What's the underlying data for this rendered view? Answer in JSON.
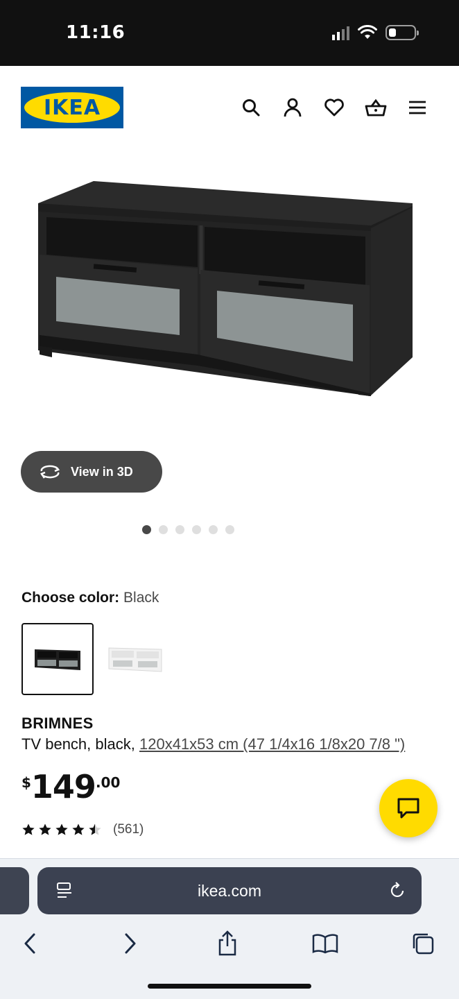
{
  "status_bar": {
    "time": "11:16",
    "battery_level": 0.3
  },
  "header": {
    "logo_text": "IKEA",
    "icons": [
      "search-icon",
      "account-icon",
      "heart-icon",
      "cart-icon",
      "menu-icon"
    ]
  },
  "gallery": {
    "view3d_label": "View in 3D",
    "image_count": 6,
    "active_index": 0
  },
  "color_choice": {
    "label": "Choose color:",
    "value": "Black",
    "options": [
      "Black",
      "White"
    ],
    "selected": 0
  },
  "product": {
    "name": "BRIMNES",
    "description": "TV bench, black, ",
    "measurements": "120x41x53 cm (47 1/4x16 1/8x20 7/8 \")",
    "price_currency": "$",
    "price_int": "149",
    "price_dec": ".00",
    "rating": 4.5,
    "review_count": "(561)"
  },
  "browser": {
    "url": "ikea.com"
  },
  "colors": {
    "ikea_blue": "#0058a3",
    "ikea_yellow": "#ffdb00",
    "dark_button": "#484848"
  }
}
